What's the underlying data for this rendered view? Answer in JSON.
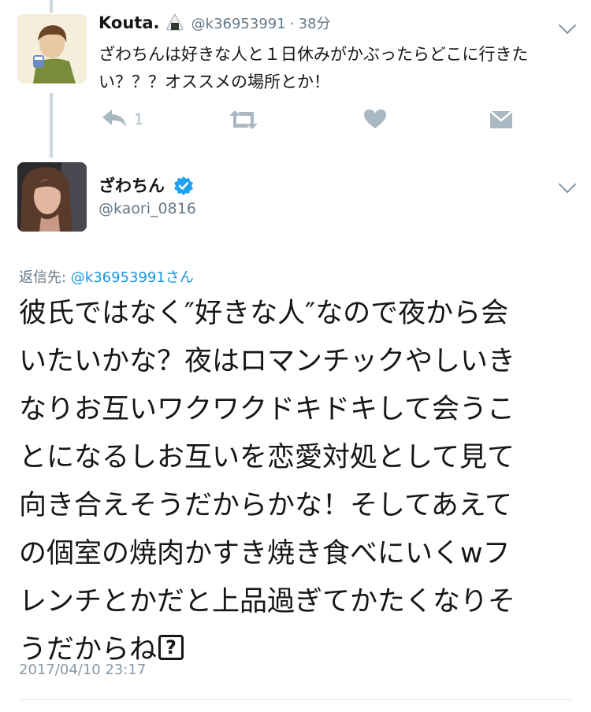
{
  "reply_tweet": {
    "display_name": "Kouta.",
    "handle": "@k36953991",
    "time_sep": "·",
    "time_ago": "38分",
    "text": "ざわちんは好きな人と１日休みがかぶったらどこに行きたい？？？オススメの場所とか！",
    "reply_count": "1",
    "icons": [
      "reply-icon",
      "retweet-icon",
      "like-icon",
      "dm-icon",
      "chevron-down-icon",
      "onigiri-icon"
    ]
  },
  "main_tweet": {
    "display_name": "ざわちん",
    "handle": "@kaori_0816",
    "replying_prefix": "返信先: ",
    "replying_mention": "@k36953991さん",
    "lines": [
      "彼氏ではなく″好きな人″なので夜から会",
      "いたいかな？夜はロマンチックやしいき",
      "なりお互いワクワクドキドキして会うこ",
      "とになるしお互いを恋愛対処として見て",
      "向き合えそうだからかな！そしてあえて",
      "の個室の焼肉かすき焼き食べにいくwフ",
      "レンチとかだと上品過ぎてかたくなりそ",
      "うだからね"
    ],
    "emoji_placeholder": "?",
    "timestamp": "2017/04/10 23:17",
    "icons": [
      "verified-badge-icon",
      "chevron-down-icon"
    ]
  },
  "colors": {
    "accent": "#1b95e0",
    "verified": "#1da1f2",
    "muted": "#657786",
    "icon_gray": "#aab8c2"
  }
}
